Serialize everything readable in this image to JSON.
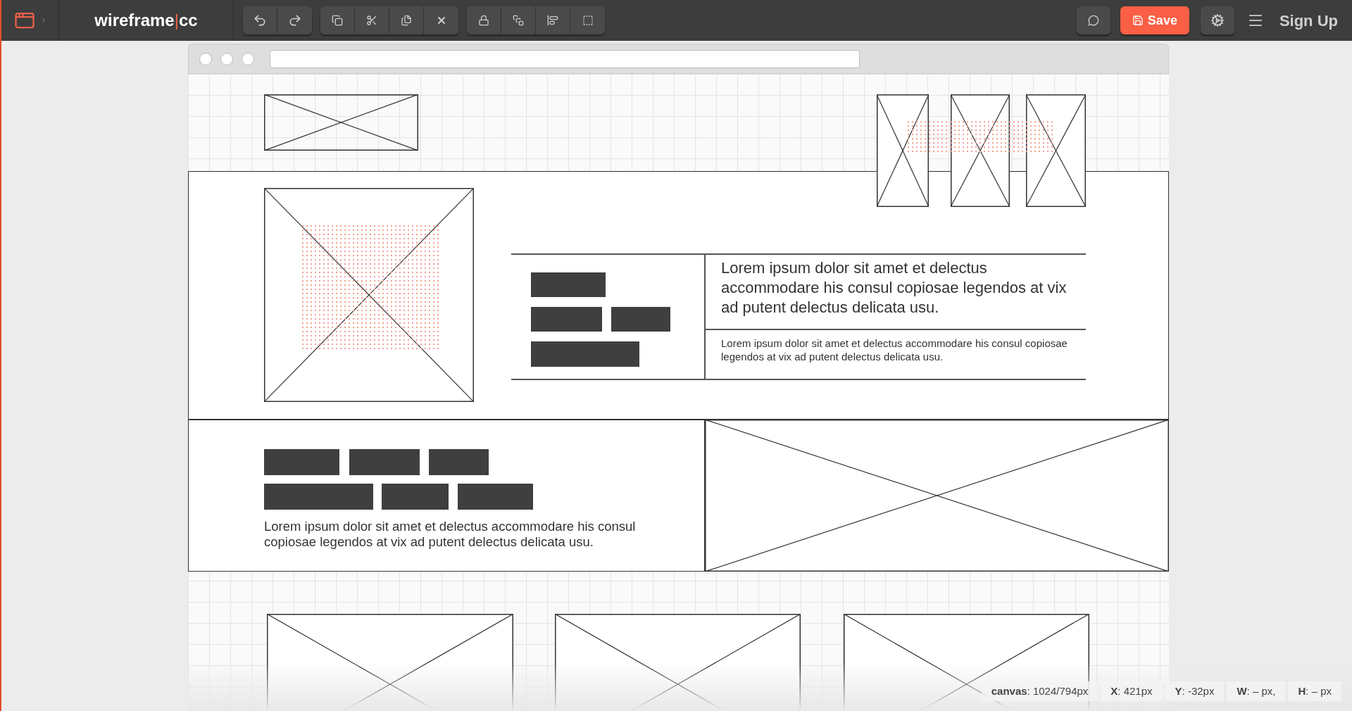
{
  "brand": {
    "name_left": "wireframe",
    "separator": "|",
    "name_right": "cc"
  },
  "toolbar": {
    "save_label": "Save",
    "signup_label": "Sign Up"
  },
  "wireframe": {
    "feature_heading": "Lorem ipsum dolor sit amet et delectus accommodare his consul copiosae legendos at vix ad putent delectus delicata usu.",
    "feature_body": "Lorem ipsum dolor sit amet et delectus accommodare his consul copiosae legendos at vix ad putent delectus delicata usu.",
    "section_body": "Lorem ipsum dolor sit amet et delectus accommodare his consul copiosae legendos at vix ad putent delectus delicata usu."
  },
  "status_bar": [
    {
      "text": "**canvas**: 1024/794px"
    },
    {
      "text": "**X**: 421px"
    },
    {
      "text": "**Y**: -32px"
    },
    {
      "text": "**W**: – px,"
    },
    {
      "text": "**H**: – px"
    }
  ]
}
